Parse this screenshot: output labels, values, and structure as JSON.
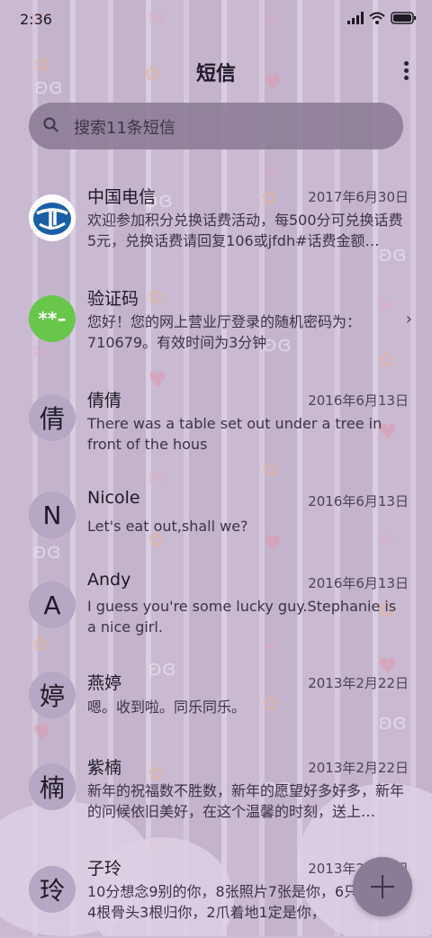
{
  "status_bar": {
    "time": "2:36",
    "battery_icon": "battery-icon",
    "wifi_icon": "wifi-icon",
    "signal_icon": "signal-icon"
  },
  "header": {
    "title": "短信",
    "more_icon": "more-vertical-icon"
  },
  "search": {
    "placeholder": "搜索11条短信",
    "icon": "search-icon"
  },
  "messages": [
    {
      "name": "中国电信",
      "date": "2017年6月30日",
      "preview": "欢迎参加积分兑换话费活动，每500分可兑换话费5元，兑换话费请回复106或jfdh#话费金额…",
      "avatar_type": "china-telecom-logo"
    },
    {
      "name": "验证码",
      "date": "",
      "preview": "您好！您的网上营业厅登录的随机密码为：710679。有效时间为3分钟",
      "avatar_text": "**–",
      "avatar_type": "verification-code"
    },
    {
      "name": "倩倩",
      "date": "2016年6月13日",
      "preview": "There was a table set out under a tree in front of the hous",
      "avatar_text": "倩"
    },
    {
      "name": "Nicole",
      "date": "2016年6月13日",
      "preview": "Let's eat out,shall we?",
      "avatar_text": "N"
    },
    {
      "name": "Andy",
      "date": "2016年6月13日",
      "preview": "I guess you're some lucky guy.Stephanie is a nice girl.",
      "avatar_text": "A"
    },
    {
      "name": "燕婷",
      "date": "2013年2月22日",
      "preview": "嗯。收到啦。同乐同乐。",
      "avatar_text": "婷"
    },
    {
      "name": "紫楠",
      "date": "2013年2月22日",
      "preview": "新年的祝福数不胜数，新年的愿望好多好多，新年的问候依旧美好，在这个温馨的时刻，送上…",
      "avatar_text": "楠"
    },
    {
      "name": "子玲",
      "date": "2013年2月22日",
      "preview": "10分想念9别的你，8张照片7张是你，6只像你，4根骨头3根归你，2爪着地1定是你，",
      "avatar_text": "玲"
    }
  ],
  "fab": {
    "icon": "plus-icon"
  },
  "colors": {
    "background": "#cdbed4",
    "search_bg": "#8d7d98",
    "avatar_bg": "#b6a7c4",
    "verification_green": "#68c64a",
    "telecom_blue": "#1a5ea8"
  }
}
